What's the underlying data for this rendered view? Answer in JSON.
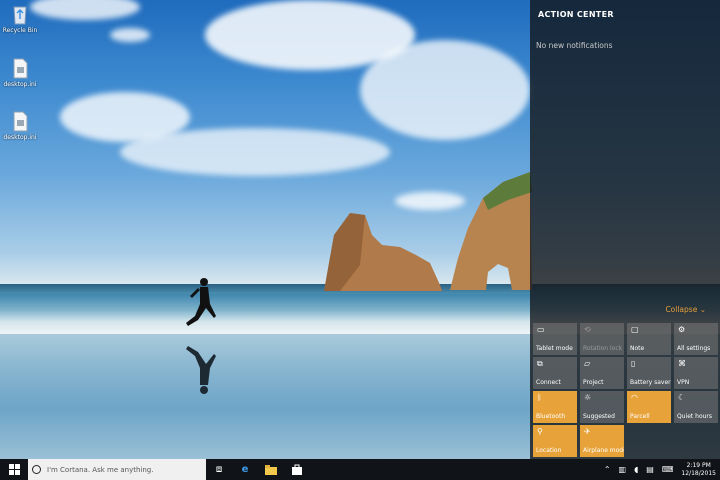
{
  "desktop": {
    "icons": [
      {
        "label": "Recycle Bin",
        "icon": "recycle-bin-icon"
      },
      {
        "label": "desktop.ini",
        "icon": "file-icon"
      },
      {
        "label": "desktop.ini",
        "icon": "file-icon"
      }
    ]
  },
  "action_center": {
    "title": "ACTION CENTER",
    "notifications": "No new notifications",
    "collapse_label": "Collapse",
    "accent": "#e7a33a",
    "tiles": [
      {
        "label": "Tablet mode",
        "icon": "tablet-icon",
        "on": false,
        "dim": false
      },
      {
        "label": "Rotation lock",
        "icon": "rotation-lock-icon",
        "on": false,
        "dim": true
      },
      {
        "label": "Note",
        "icon": "note-icon",
        "on": false,
        "dim": false
      },
      {
        "label": "All settings",
        "icon": "gear-icon",
        "on": false,
        "dim": false
      },
      {
        "label": "Connect",
        "icon": "connect-icon",
        "on": false,
        "dim": false
      },
      {
        "label": "Project",
        "icon": "project-icon",
        "on": false,
        "dim": false
      },
      {
        "label": "Battery saver",
        "icon": "battery-icon",
        "on": false,
        "dim": false
      },
      {
        "label": "VPN",
        "icon": "vpn-icon",
        "on": false,
        "dim": false
      },
      {
        "label": "Bluetooth",
        "icon": "bluetooth-icon",
        "on": true,
        "dim": false
      },
      {
        "label": "Suggested",
        "icon": "brightness-icon",
        "on": false,
        "dim": false
      },
      {
        "label": "Parcell",
        "icon": "wifi-icon",
        "on": true,
        "dim": false
      },
      {
        "label": "Quiet hours",
        "icon": "moon-icon",
        "on": false,
        "dim": false
      },
      {
        "label": "Location",
        "icon": "location-icon",
        "on": true,
        "dim": false
      },
      {
        "label": "Airplane mode",
        "icon": "airplane-icon",
        "on": true,
        "dim": false
      }
    ]
  },
  "taskbar": {
    "search_placeholder": "I'm Cortana. Ask me anything.",
    "time": "2:19 PM",
    "date": "12/18/2015",
    "pinned": [
      "task-view-icon",
      "edge-icon",
      "file-explorer-icon",
      "store-icon"
    ]
  }
}
